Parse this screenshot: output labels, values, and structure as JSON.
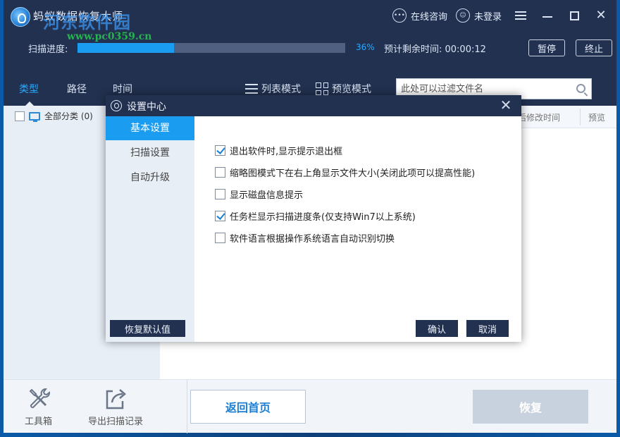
{
  "window": {
    "title": "蚂蚁数据恢复大师",
    "watermark": "河东软件园",
    "watermark_url": "www.pc0359.cn",
    "consult": "在线咨询",
    "login": "未登录"
  },
  "scan": {
    "label": "扫描进度:",
    "progress": 36,
    "percent_text": "36%",
    "remaining": "预计剩余时间: 00:00:12",
    "pause": "暂停",
    "stop": "终止"
  },
  "nav": {
    "tabs": [
      "类型",
      "路径",
      "时间"
    ],
    "active_tab": "类型",
    "list_mode": "列表模式",
    "preview_mode": "预览模式",
    "filter_placeholder": "此处可以过滤文件名"
  },
  "left_panel": {
    "all_category": "全部分类 (0)"
  },
  "columns": {
    "modified": "后修改时间",
    "preview": "预览"
  },
  "bottom": {
    "toolbox": "工具箱",
    "export": "导出扫描记录",
    "home": "返回首页",
    "recover": "恢复"
  },
  "dialog": {
    "title": "设置中心",
    "side_items": [
      "基本设置",
      "扫描设置",
      "自动升级"
    ],
    "active_side": "基本设置",
    "options": [
      {
        "label": "退出软件时,显示提示退出框",
        "checked": true
      },
      {
        "label": "缩略图模式下在右上角显示文件大小(关闭此项可以提高性能)",
        "checked": false
      },
      {
        "label": "显示磁盘信息提示",
        "checked": false
      },
      {
        "label": "任务栏显示扫描进度条(仅支持Win7以上系统)",
        "checked": true
      },
      {
        "label": "软件语言根据操作系统语言自动识别切换",
        "checked": false
      }
    ],
    "restore": "恢复默认值",
    "confirm": "确认",
    "cancel": "取消"
  },
  "colors": {
    "header_bg": "#223150",
    "accent": "#1a9df0",
    "panel_bg": "#e8eef6"
  },
  "icons": {
    "chat": "chat-bubble-icon",
    "user": "user-icon",
    "menu": "hamburger-menu-icon",
    "minimize": "minimize-icon",
    "maximize": "maximize-icon",
    "close": "close-icon",
    "list": "list-view-icon",
    "grid": "grid-view-icon",
    "search": "search-icon",
    "toolbox": "wrench-screwdriver-icon",
    "export": "export-share-icon",
    "monitor": "monitor-icon",
    "logo": "ant-logo-icon"
  }
}
